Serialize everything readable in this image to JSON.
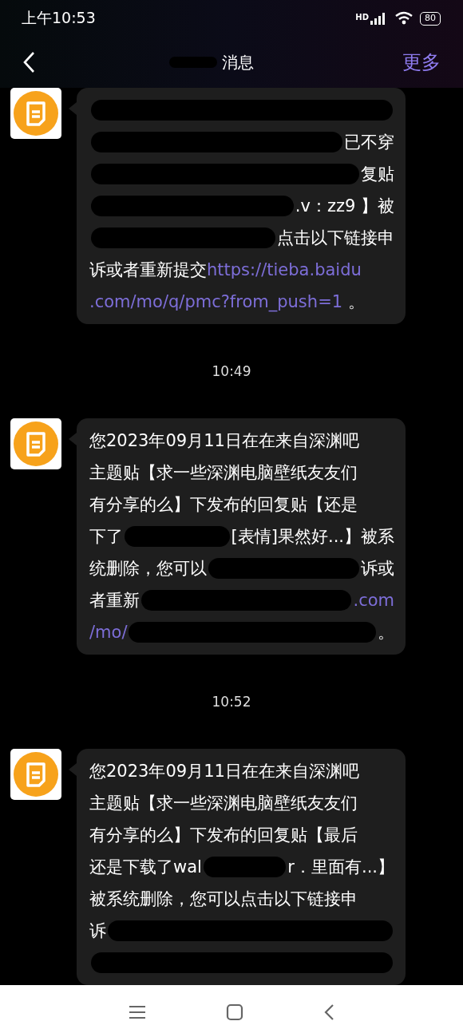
{
  "status_bar": {
    "time": "上午10:53",
    "network_label": "HD",
    "battery": "80"
  },
  "header": {
    "title": [
      {
        "kind": "redacted"
      },
      {
        "kind": "text",
        "text": "消息"
      }
    ],
    "more": "更多"
  },
  "feed": [
    {
      "kind": "message",
      "lines": [
        [
          {
            "kind": "redacted"
          }
        ],
        [
          {
            "kind": "redacted"
          },
          {
            "kind": "text",
            "text": "已不穿"
          }
        ],
        [
          {
            "kind": "redacted"
          },
          {
            "kind": "text",
            "text": "复贴"
          }
        ],
        [
          {
            "kind": "redacted"
          },
          {
            "kind": "text",
            "text": ".v：zz9 】被"
          }
        ],
        [
          {
            "kind": "redacted"
          },
          {
            "kind": "text",
            "text": "点击以下链接申"
          }
        ],
        [
          {
            "kind": "text",
            "text": "诉或者重新提交"
          },
          {
            "kind": "link",
            "text": "https://tieba.baidu"
          }
        ],
        [
          {
            "kind": "link",
            "text": ".com/mo/q/pmc?from_push=1"
          },
          {
            "kind": "text",
            "text": " 。"
          }
        ]
      ]
    },
    {
      "kind": "time",
      "text": "10:49"
    },
    {
      "kind": "message",
      "lines": [
        [
          {
            "kind": "text",
            "text": "您2023年09月11日在在来自深渊吧"
          }
        ],
        [
          {
            "kind": "text",
            "text": "主题贴【求一些深渊电脑壁纸友友们"
          }
        ],
        [
          {
            "kind": "text",
            "text": "有分享的么】下发布的回复贴【还是"
          }
        ],
        [
          {
            "kind": "text",
            "text": "下了"
          },
          {
            "kind": "redacted"
          },
          {
            "kind": "text",
            "text": "[表情]果然好...】被系"
          }
        ],
        [
          {
            "kind": "text",
            "text": "统删除，您可以"
          },
          {
            "kind": "redacted"
          },
          {
            "kind": "text",
            "text": "诉或"
          }
        ],
        [
          {
            "kind": "text",
            "text": "者重新"
          },
          {
            "kind": "redacted"
          },
          {
            "kind": "link",
            "text": ".com"
          }
        ],
        [
          {
            "kind": "link",
            "text": "/mo/"
          },
          {
            "kind": "redacted"
          },
          {
            "kind": "text",
            "text": "。"
          }
        ]
      ]
    },
    {
      "kind": "time",
      "text": "10:52"
    },
    {
      "kind": "message",
      "lines": [
        [
          {
            "kind": "text",
            "text": "您2023年09月11日在在来自深渊吧"
          }
        ],
        [
          {
            "kind": "text",
            "text": "主题贴【求一些深渊电脑壁纸友友们"
          }
        ],
        [
          {
            "kind": "text",
            "text": "有分享的么】下发布的回复贴【最后"
          }
        ],
        [
          {
            "kind": "text",
            "text": "还是下载了wal"
          },
          {
            "kind": "redacted"
          },
          {
            "kind": "text",
            "text": "r．里面有...】"
          }
        ],
        [
          {
            "kind": "text",
            "text": "被系统删除，您可以点击以下链接申"
          }
        ],
        [
          {
            "kind": "text",
            "text": "诉"
          },
          {
            "kind": "redacted"
          }
        ],
        [
          {
            "kind": "redacted"
          }
        ]
      ]
    }
  ]
}
